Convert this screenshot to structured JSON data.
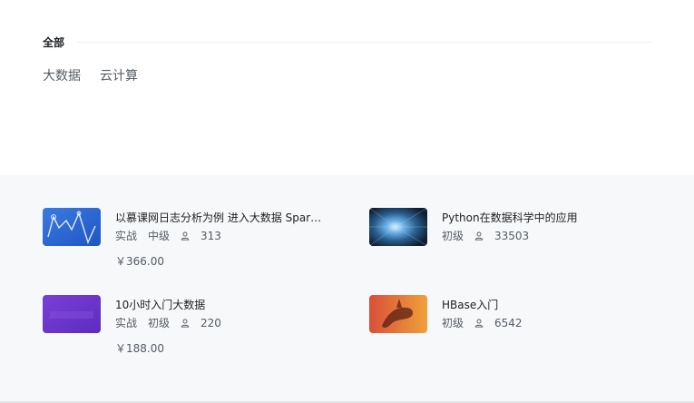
{
  "category": {
    "title": "全部",
    "tags": [
      "大数据",
      "云计算"
    ]
  },
  "courses": [
    {
      "title": "以慕课网日志分析为例 进入大数据 Spar…",
      "type": "实战",
      "level": "中级",
      "learners": "313",
      "price": "￥366.00",
      "thumb": "blue-chart-thumbnail"
    },
    {
      "title": "Python在数据科学中的应用",
      "type": "",
      "level": "初级",
      "learners": "33503",
      "price": "",
      "thumb": "data-tunnel-thumbnail"
    },
    {
      "title": "10小时入门大数据",
      "type": "实战",
      "level": "初级",
      "learners": "220",
      "price": "￥188.00",
      "thumb": "purple-thumbnail"
    },
    {
      "title": "HBase入门",
      "type": "",
      "level": "初级",
      "learners": "6542",
      "price": "",
      "thumb": "orca-thumbnail"
    }
  ],
  "colors": {
    "text_primary": "#1c1f21",
    "text_secondary": "#545c63",
    "section_bg": "#f7f8fa"
  }
}
